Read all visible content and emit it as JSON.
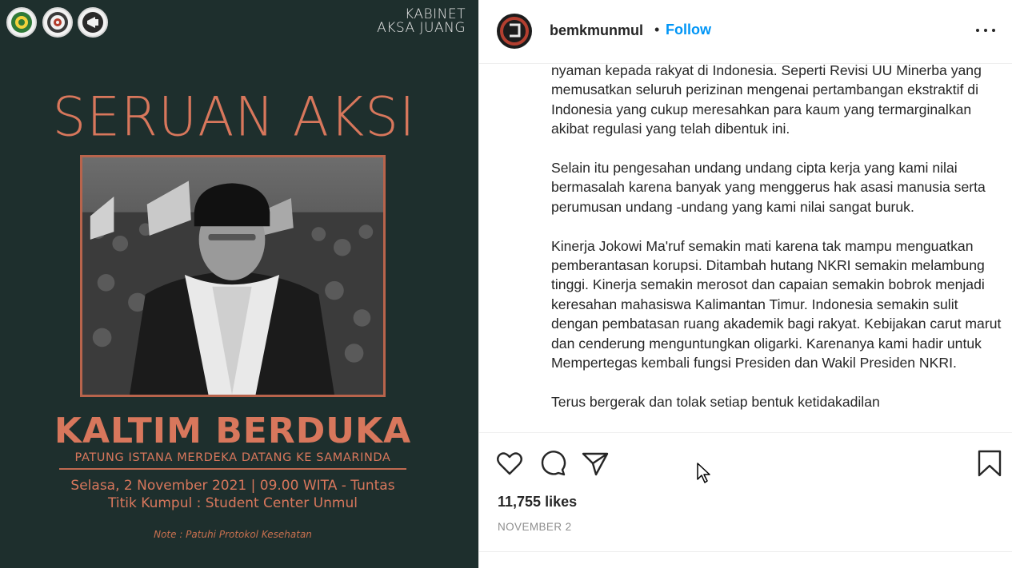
{
  "post_image": {
    "org_label_line1": "KABINET",
    "org_label_line2": "AKSA JUANG",
    "headline": "SERUAN AKSI",
    "title": "KALTIM BERDUKA",
    "subtitle": "PATUNG ISTANA MERDEKA DATANG KE SAMARINDA",
    "schedule": "Selasa, 2 November 2021 | 09.00 WITA - Tuntas",
    "meeting_point": "Titik Kumpul : Student Center Unmul",
    "note": "Note : Patuhi Protokol Kesehatan",
    "accent_color": "#d8775c",
    "background_color": "#1e2f2d",
    "logos": [
      "university-seal-logo",
      "target-logo",
      "megaphone-logo"
    ]
  },
  "header": {
    "username": "bemkmunmul",
    "separator": "•",
    "follow_label": "Follow"
  },
  "caption": {
    "paragraphs": [
      "nyaman kepada rakyat di Indonesia. Seperti Revisi UU Minerba yang memusatkan seluruh perizinan mengenai pertambangan ekstraktif di Indonesia yang cukup meresahkan para kaum yang termarginalkan akibat regulasi yang telah dibentuk ini.",
      "Selain itu pengesahan undang undang cipta kerja yang kami nilai bermasalah karena banyak yang menggerus hak asasi manusia serta perumusan undang -undang yang kami nilai sangat buruk.",
      "Kinerja Jokowi Ma'ruf semakin mati karena tak mampu menguatkan pemberantasan korupsi. Ditambah hutang NKRI semakin melambung tinggi. Kinerja semakin merosot dan capaian semakin bobrok menjadi keresahan mahasiswa Kalimantan Timur. Indonesia semakin sulit dengan pembatasan ruang akademik bagi rakyat. Kebijakan carut marut dan cenderung menguntungkan oligarki. Karenanya kami hadir untuk Mempertegas kembali fungsi Presiden dan Wakil Presiden NKRI.",
      "Terus bergerak dan tolak setiap bentuk ketidakadilan"
    ]
  },
  "actions": {
    "icons": [
      "heart-icon",
      "comment-icon",
      "share-icon",
      "bookmark-icon"
    ],
    "likes": "11,755 likes",
    "date": "NOVEMBER 2"
  },
  "colors": {
    "link_blue": "#0095f6",
    "text": "#262626",
    "muted": "#8e8e8e"
  }
}
